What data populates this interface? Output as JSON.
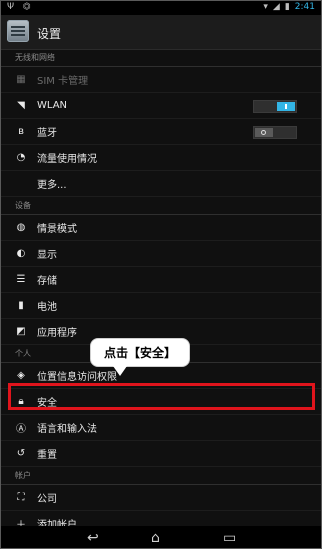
{
  "status_bar": {
    "left": "Ψ ⏣",
    "time": "2:41"
  },
  "header": {
    "title": "设置"
  },
  "sections": [
    {
      "title": "无线和网络",
      "items": [
        {
          "label": "SIM 卡管理",
          "icon": "sim-icon",
          "dim": true
        },
        {
          "label": "WLAN",
          "icon": "wifi-icon",
          "toggle": "on"
        },
        {
          "label": "蓝牙",
          "icon": "bluetooth-icon",
          "toggle": "off"
        },
        {
          "label": "流量使用情况",
          "icon": "data-usage-icon"
        },
        {
          "label": "更多...",
          "icon": ""
        }
      ]
    },
    {
      "title": "设备",
      "items": [
        {
          "label": "情景模式",
          "icon": "sound-profile-icon"
        },
        {
          "label": "显示",
          "icon": "display-icon"
        },
        {
          "label": "存储",
          "icon": "storage-icon"
        },
        {
          "label": "电池",
          "icon": "battery-icon"
        },
        {
          "label": "应用程序",
          "icon": "apps-icon"
        }
      ]
    },
    {
      "title": "个人",
      "items": [
        {
          "label": "位置信息访问权限",
          "icon": "location-icon"
        },
        {
          "label": "安全",
          "icon": "lock-icon"
        },
        {
          "label": "语言和输入法",
          "icon": "language-icon"
        },
        {
          "label": "重置",
          "icon": "reset-icon"
        }
      ]
    },
    {
      "title": "帐户",
      "items": [
        {
          "label": "公司",
          "icon": "corporate-icon"
        },
        {
          "label": "添加帐户",
          "icon": "add-icon"
        }
      ]
    }
  ],
  "callout": {
    "text": "点击【安全】"
  },
  "colors": {
    "accent": "#33b5e5",
    "highlight": "#e0141c"
  }
}
